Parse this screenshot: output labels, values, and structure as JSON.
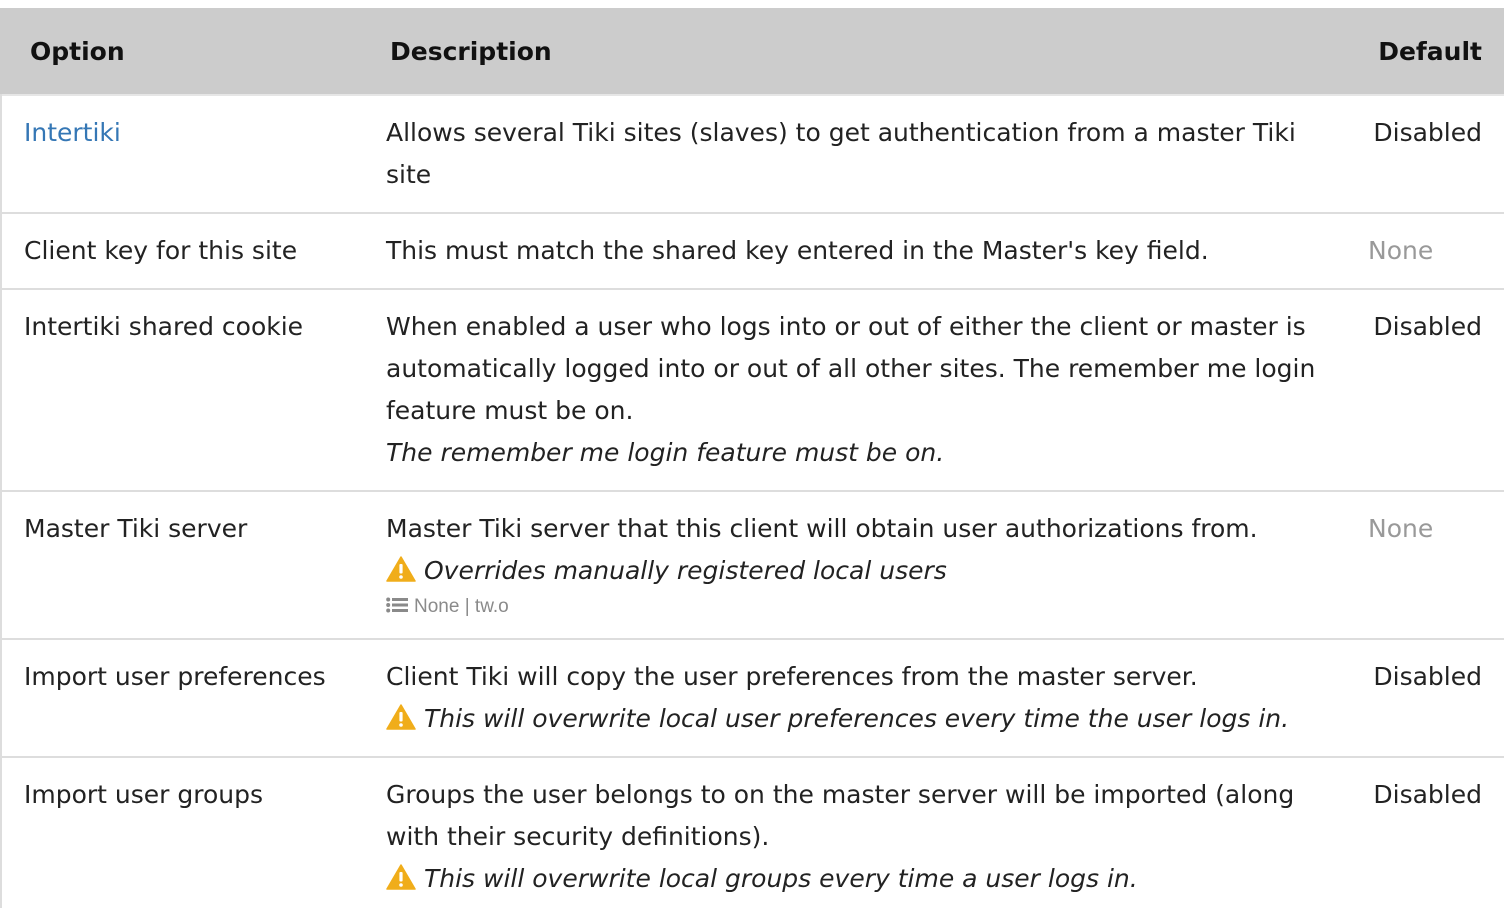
{
  "header": {
    "option": "Option",
    "description": "Description",
    "default": "Default"
  },
  "rows": [
    {
      "option": "Intertiki",
      "option_is_link": true,
      "description": "Allows several Tiki sites (slaves) to get authentication from a master Tiki site",
      "default": "Disabled"
    },
    {
      "option": "Client key for this site",
      "description": "This must match the shared key entered in the Master's key field.",
      "default": "None"
    },
    {
      "option": "Intertiki shared cookie",
      "description": "When enabled a user who logs into or out of either the client or master is automatically logged into or out of all other sites. The remember me login feature must be on.",
      "note": "The remember me login feature must be on.",
      "default": "Disabled"
    },
    {
      "option": "Master Tiki server",
      "description": "Master Tiki server that this client will obtain user authorizations from.",
      "warning": "Overrides manually registered local users",
      "choices": "None | tw.o",
      "default": "None"
    },
    {
      "option": "Import user preferences",
      "description": "Client Tiki will copy the user preferences from the master server.",
      "warning": "This will overwrite local user preferences every time the user logs in.",
      "default": "Disabled"
    },
    {
      "option": "Import user groups",
      "description": "Groups the user belongs to on the master server will be imported (along with their security definitions).",
      "warning": "This will overwrite local groups every time a user logs in.",
      "default": "Disabled"
    }
  ],
  "colors": {
    "header_bg": "#cccccc",
    "link": "#3577b5",
    "muted": "#999999",
    "warning": "#f0ad1a"
  },
  "icons": {
    "warning": "warning-triangle-icon",
    "list": "list-icon"
  }
}
